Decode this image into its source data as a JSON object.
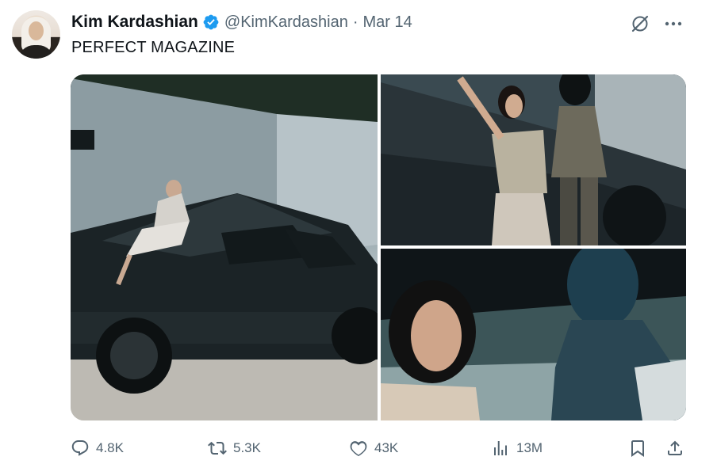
{
  "author": {
    "name": "Kim Kardashian",
    "handle": "@KimKardashian",
    "separator": "·",
    "date": "Mar 14",
    "verified": true
  },
  "tweet": {
    "text": "PERFECT MAGAZINE"
  },
  "icons": {
    "verified": "verified-badge-icon",
    "grok": "grok-icon",
    "more": "more-icon",
    "reply": "reply-icon",
    "retweet": "retweet-icon",
    "like": "heart-icon",
    "views": "views-icon",
    "bookmark": "bookmark-icon",
    "share": "share-icon"
  },
  "metrics": {
    "replies": "4.8K",
    "retweets": "5.3K",
    "likes": "43K",
    "views": "13M"
  },
  "colors": {
    "text": "#0f1419",
    "secondary": "#536471",
    "verified": "#1d9bf0"
  }
}
